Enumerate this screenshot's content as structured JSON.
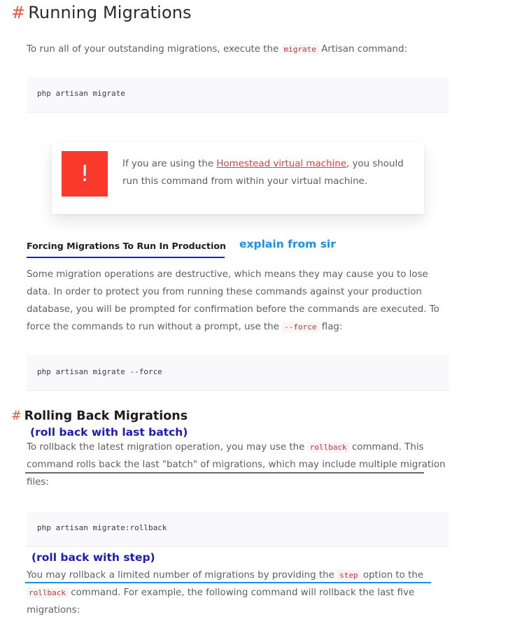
{
  "section1": {
    "hash": "#",
    "title": "Running Migrations",
    "intro_before": "To run all of your outstanding migrations, execute the ",
    "intro_code": "migrate",
    "intro_after": " Artisan command:",
    "code": "php artisan migrate"
  },
  "callout": {
    "icon": "!",
    "text_before": "If you are using the ",
    "link": "Homestead virtual machine",
    "text_after": ", you should run this command from within your virtual machine."
  },
  "forcing": {
    "heading": "Forcing Migrations To Run In Production",
    "annotation": "explain from sir",
    "para_before": "Some migration operations are destructive, which means they may cause you to lose data. In order to protect you from running these commands against your production database, you will be prompted for confirmation before the commands are executed. To force the commands to run without a prompt, use the ",
    "para_code": "--force",
    "para_after": " flag:",
    "code": "php artisan migrate --force"
  },
  "rolling": {
    "hash": "#",
    "heading": "Rolling Back Migrations",
    "annotation1": "(roll back with last batch)",
    "para1_before": "To rollback the latest migration operation, you may use the ",
    "para1_code": "rollback",
    "para1_after": " command. This command rolls back the last \"batch\" of migrations, which may include multiple migration files:",
    "code": "php artisan migrate:rollback",
    "annotation2": "(roll back with step)",
    "para2_a": "You may rollback a limited number of migrations by providing the ",
    "para2_code1": "step",
    "para2_b": " option to the ",
    "para2_code2": "rollback",
    "para2_c": " command. For example, the following command will rollback the last five migrations:"
  },
  "colors": {
    "accent_red": "#e8553e",
    "annotation_blue": "#1a8fe6",
    "annotation_navy": "#1b1bb8"
  }
}
